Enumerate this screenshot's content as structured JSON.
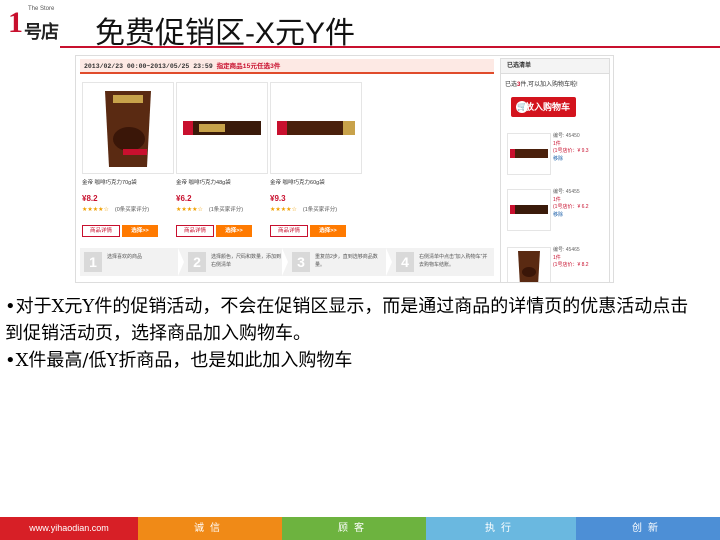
{
  "logo": {
    "numeral": "1",
    "rest": "号店",
    "tagline": "The Store"
  },
  "slide_title": "免费促销区-X元Y件",
  "screenshot": {
    "promo": {
      "time": "2013/02/23 00:00~2013/05/25 23:59",
      "label": "指定商品15元任选3件"
    },
    "products": [
      {
        "name": "金帝 咖啡巧克力70g袋",
        "price": "¥8.2",
        "stars": "★★★★☆",
        "reviews": "(0条买家评分)",
        "detail": "商品详情",
        "choose": "选择>>"
      },
      {
        "name": "金帝 咖啡巧克力48g袋",
        "price": "¥6.2",
        "stars": "★★★★☆",
        "reviews": "(1条买家评分)",
        "detail": "商品详情",
        "choose": "选择>>"
      },
      {
        "name": "金帝 咖啡巧克力60g袋",
        "price": "¥9.3",
        "stars": "★★★★☆",
        "reviews": "(1条买家评分)",
        "detail": "商品详情",
        "choose": "选择>>"
      }
    ],
    "steps": [
      {
        "num": "1",
        "text": "选择喜欢的商品"
      },
      {
        "num": "2",
        "text": "选择颜色，尺码和数量，添加到右侧清单"
      },
      {
        "num": "3",
        "text": "重复前2步，直到选够商品数量。"
      },
      {
        "num": "4",
        "text": "右侧清单中点击“加入购物车”并去购物车结账。"
      }
    ],
    "cart": {
      "header": "已选清单",
      "tip_prefix": "已选",
      "tip_count": "3",
      "tip_suffix": "件,可以加入购物车啦!",
      "add_button": "放入购物车",
      "items": [
        {
          "code": "编号: 45450",
          "qty": "1件",
          "price": "(1号店价：¥ 9.3",
          "remove": "移除"
        },
        {
          "code": "编号: 45455",
          "qty": "1件",
          "price": "(1号店价：¥ 6.2",
          "remove": "移除"
        },
        {
          "code": "编号: 45465",
          "qty": "1件",
          "price": "(1号店价：¥ 8.2",
          "remove": "移除"
        }
      ]
    }
  },
  "bullets": [
    "•对于X元Y件的促销活动，不会在促销区显示，而是通过商品的详情页的优惠活动点击到促销活动页，选择商品加入购物车。",
    "•X件最高/低Y折商品，也是如此加入购物车"
  ],
  "footer": {
    "segments": [
      {
        "label": "www.yihaodian.com",
        "color": "#d71f26"
      },
      {
        "label": "诚信",
        "color": "#f08a17"
      },
      {
        "label": "顾客",
        "color": "#6db33f"
      },
      {
        "label": "执行",
        "color": "#6ab8e0"
      },
      {
        "label": "创新",
        "color": "#4d8fd6"
      }
    ]
  },
  "colors": {
    "brand_red": "#c8102e",
    "orange": "#ff7a00"
  }
}
